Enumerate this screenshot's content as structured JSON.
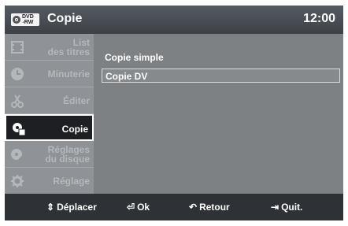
{
  "header": {
    "disc_label_top": "DVD",
    "disc_label_bottom": "-RW",
    "title": "Copie",
    "time": "12:00"
  },
  "menu": {
    "items": [
      {
        "label_line1": "List",
        "label_line2": "des titres",
        "icon": "film-icon"
      },
      {
        "label_line1": "Minuterie",
        "label_line2": "",
        "icon": "clock-icon"
      },
      {
        "label_line1": "Éditer",
        "label_line2": "",
        "icon": "scissors-icon"
      },
      {
        "label_line1": "Copie",
        "label_line2": "",
        "icon": "copy-icon"
      },
      {
        "label_line1": "Réglages",
        "label_line2": "du disque",
        "icon": "disc-settings-icon"
      },
      {
        "label_line1": "Réglage",
        "label_line2": "",
        "icon": "gear-icon"
      }
    ],
    "selected_index": 3
  },
  "content": {
    "options": [
      "Copie simple",
      "Copie DV"
    ],
    "selected_index": 1
  },
  "footer": {
    "move_label": "Déplacer",
    "ok_label": "Ok",
    "back_label": "Retour",
    "quit_label": "Quit."
  },
  "colors": {
    "panel": "#777a7d",
    "menu_bg": "#8f9296",
    "active_bg": "#1d1f22",
    "bar": "#2e3135"
  }
}
